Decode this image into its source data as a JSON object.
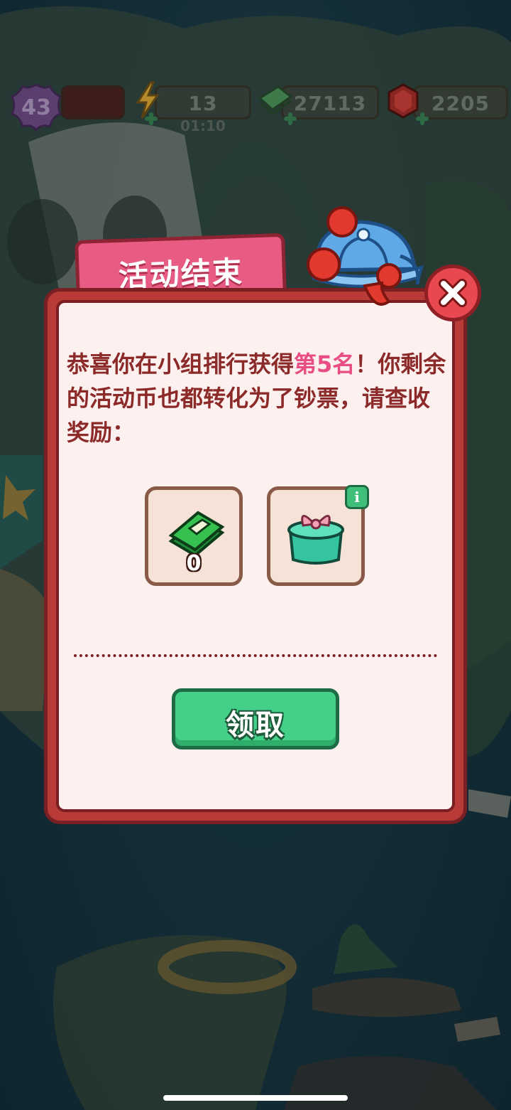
{
  "hud": {
    "level": "43",
    "energy": {
      "value": "13",
      "timer": "01:10"
    },
    "cash": "27113",
    "gems": "2205"
  },
  "dialog": {
    "title": "活动结束",
    "message_before": "恭喜你在小组排行获得",
    "message_highlight": "第5名",
    "message_after": "！你剩余的活动币也都转化为了钞票，请查收奖励：",
    "rewards": [
      {
        "icon": "cash-stack-icon",
        "count": "0"
      },
      {
        "icon": "gift-box-icon"
      }
    ],
    "claim_label": "领取"
  },
  "colors": {
    "tab": "#e85c84",
    "panel_border": "#b93b38",
    "panel_fill": "#fcf1ee",
    "text": "#8c2a2a",
    "highlight": "#e84d84",
    "button": "#45d08a",
    "close": "#e8484f"
  }
}
